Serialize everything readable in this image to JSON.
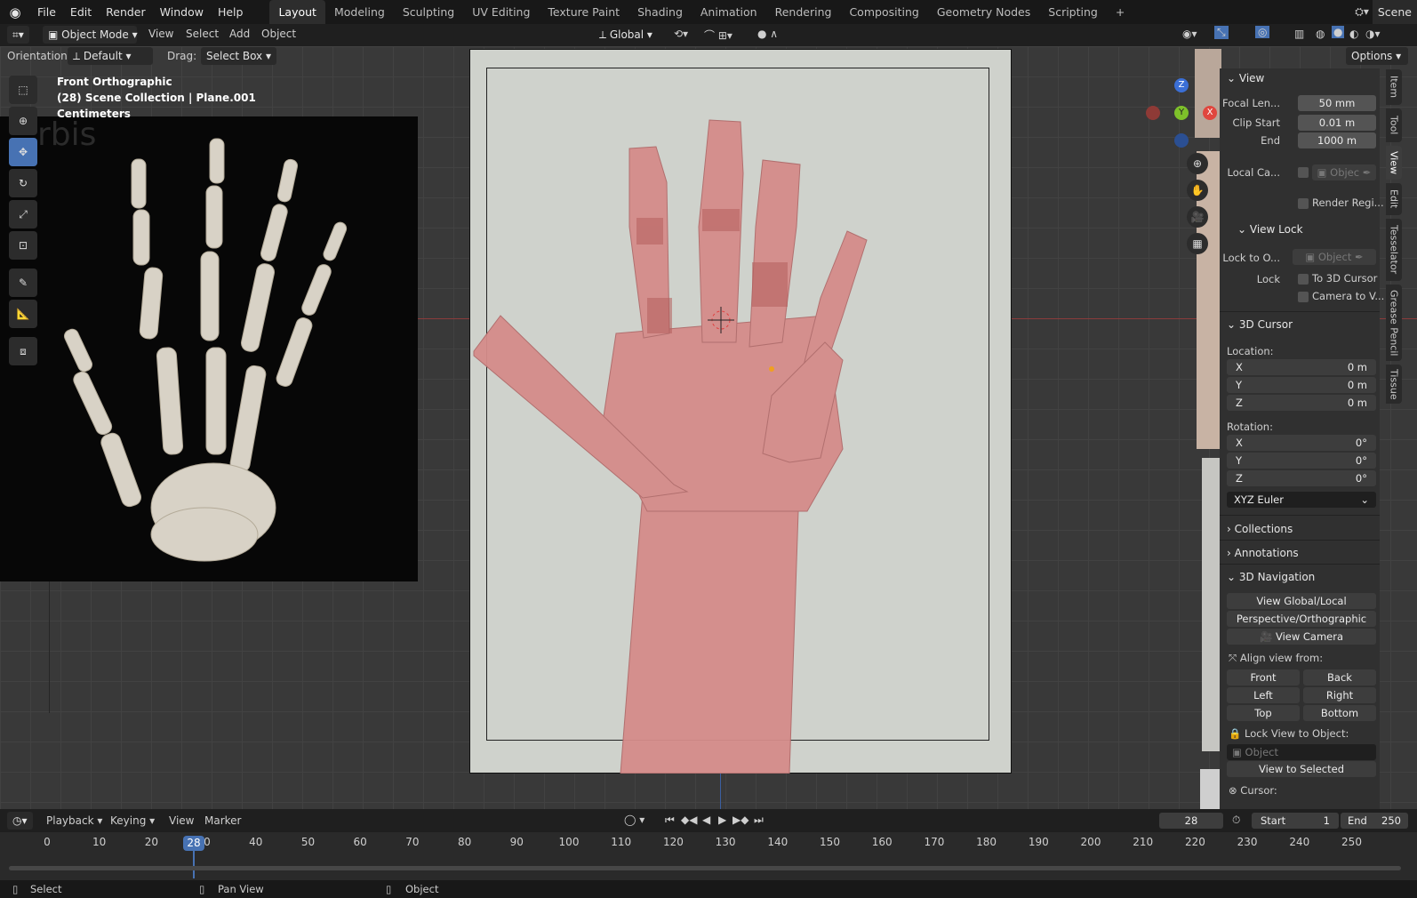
{
  "topbar": {
    "menus": [
      "File",
      "Edit",
      "Render",
      "Window",
      "Help"
    ],
    "workspaces": [
      "Layout",
      "Modeling",
      "Sculpting",
      "UV Editing",
      "Texture Paint",
      "Shading",
      "Animation",
      "Rendering",
      "Compositing",
      "Geometry Nodes",
      "Scripting"
    ],
    "active_workspace": "Layout",
    "add_tab": "+",
    "scene_label": "Scene"
  },
  "header": {
    "mode": "Object Mode",
    "menus": [
      "View",
      "Select",
      "Add",
      "Object"
    ],
    "transform_orientation": "Global",
    "options": "Options"
  },
  "toolsettings": {
    "orientation_label": "Orientation:",
    "orientation_value": "Default",
    "drag_label": "Drag:",
    "drag_value": "Select Box"
  },
  "overlay": {
    "view_name": "Front Orthographic",
    "collection": "(28) Scene Collection | Plane.001",
    "units": "Centimeters",
    "watermark": "rbis"
  },
  "gizmo": {
    "z": "Z",
    "y": "Y",
    "x": "X"
  },
  "npanel": {
    "view": {
      "title": "View",
      "focal_label": "Focal Len...",
      "focal_value": "50 mm",
      "clip_start_label": "Clip Start",
      "clip_start_value": "0.01 m",
      "end_label": "End",
      "end_value": "1000 m",
      "local_cam_label": "Local Ca...",
      "local_cam_value": "Objec",
      "render_region": "Render Regi...",
      "view_lock_title": "View Lock",
      "lock_to_label": "Lock to O...",
      "lock_to_value": "Object",
      "lock_label": "Lock",
      "to_cursor": "To 3D Cursor",
      "camera_to_view": "Camera to V..."
    },
    "cursor": {
      "title": "3D Cursor",
      "location_label": "Location:",
      "x_label": "X",
      "x_value": "0 m",
      "y_label": "Y",
      "y_value": "0 m",
      "z_label": "Z",
      "z_value": "0 m",
      "rotation_label": "Rotation:",
      "rx_value": "0°",
      "ry_value": "0°",
      "rz_value": "0°",
      "euler": "XYZ Euler"
    },
    "collections": "Collections",
    "annotations": "Annotations",
    "nav": {
      "title": "3D Navigation",
      "view_global": "View Global/Local",
      "persp": "Perspective/Orthographic",
      "view_camera": "View Camera",
      "align_label": "Align view from:",
      "front": "Front",
      "back": "Back",
      "left": "Left",
      "right": "Right",
      "top": "Top",
      "bottom": "Bottom",
      "lock_view_label": "Lock View to Object:",
      "object_placeholder": "Object",
      "view_selected": "View to Selected",
      "cursor_label": "Cursor:"
    },
    "tabs": [
      "Item",
      "Tool",
      "View",
      "Edit",
      "Tesselator",
      "Grease Pencil",
      "Tissue"
    ],
    "active_tab": "View"
  },
  "timeline": {
    "menus": [
      "Playback",
      "Keying",
      "View",
      "Marker"
    ],
    "current_frame": "28",
    "start_label": "Start",
    "start_value": "1",
    "end_label": "End",
    "end_value": "250",
    "ticks": [
      "0",
      "10",
      "20",
      "30",
      "40",
      "50",
      "60",
      "70",
      "80",
      "90",
      "100",
      "110",
      "120",
      "130",
      "140",
      "150",
      "160",
      "170",
      "180",
      "190",
      "200",
      "210",
      "220",
      "230",
      "240",
      "250"
    ],
    "playhead": "28"
  },
  "status": {
    "select": "Select",
    "pan": "Pan View",
    "object": "Object"
  },
  "colors": {
    "accent": "#4772b3",
    "mesh": "#d98b8b",
    "background": "#393939"
  }
}
